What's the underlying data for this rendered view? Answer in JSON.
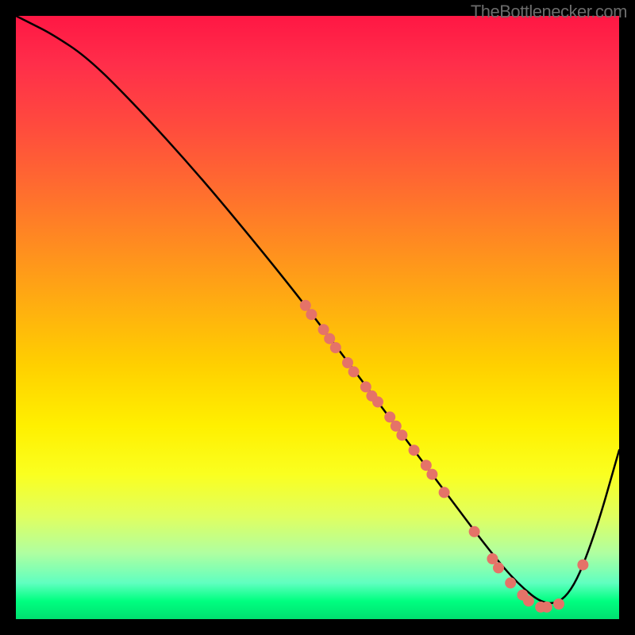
{
  "attribution": "TheBottlenecker.com",
  "chart_data": {
    "type": "line",
    "title": "",
    "xlabel": "",
    "ylabel": "",
    "xlim": [
      0,
      100
    ],
    "ylim": [
      0,
      100
    ],
    "background_gradient": "red-yellow-green-vertical",
    "series": [
      {
        "name": "bottleneck-curve",
        "x": [
          0,
          2,
          6,
          12,
          20,
          30,
          40,
          48,
          54,
          60,
          66,
          72,
          78,
          83,
          88,
          92,
          96,
          100
        ],
        "y": [
          100,
          99,
          97,
          93,
          85,
          74,
          62,
          52,
          44,
          36,
          28,
          20,
          12,
          6,
          2,
          4,
          14,
          28
        ]
      }
    ],
    "markers": [
      {
        "x": 48,
        "y": 52
      },
      {
        "x": 49,
        "y": 50.5
      },
      {
        "x": 51,
        "y": 48
      },
      {
        "x": 52,
        "y": 46.5
      },
      {
        "x": 53,
        "y": 45
      },
      {
        "x": 55,
        "y": 42.5
      },
      {
        "x": 56,
        "y": 41
      },
      {
        "x": 58,
        "y": 38.5
      },
      {
        "x": 59,
        "y": 37
      },
      {
        "x": 60,
        "y": 36
      },
      {
        "x": 62,
        "y": 33.5
      },
      {
        "x": 63,
        "y": 32
      },
      {
        "x": 64,
        "y": 30.5
      },
      {
        "x": 66,
        "y": 28
      },
      {
        "x": 68,
        "y": 25.5
      },
      {
        "x": 69,
        "y": 24
      },
      {
        "x": 71,
        "y": 21
      },
      {
        "x": 76,
        "y": 14.5
      },
      {
        "x": 79,
        "y": 10
      },
      {
        "x": 80,
        "y": 8.5
      },
      {
        "x": 82,
        "y": 6
      },
      {
        "x": 84,
        "y": 4
      },
      {
        "x": 85,
        "y": 3
      },
      {
        "x": 87,
        "y": 2
      },
      {
        "x": 88,
        "y": 2
      },
      {
        "x": 90,
        "y": 2.5
      },
      {
        "x": 94,
        "y": 9
      }
    ],
    "marker_color": "#e57368",
    "marker_radius_px": 7
  }
}
